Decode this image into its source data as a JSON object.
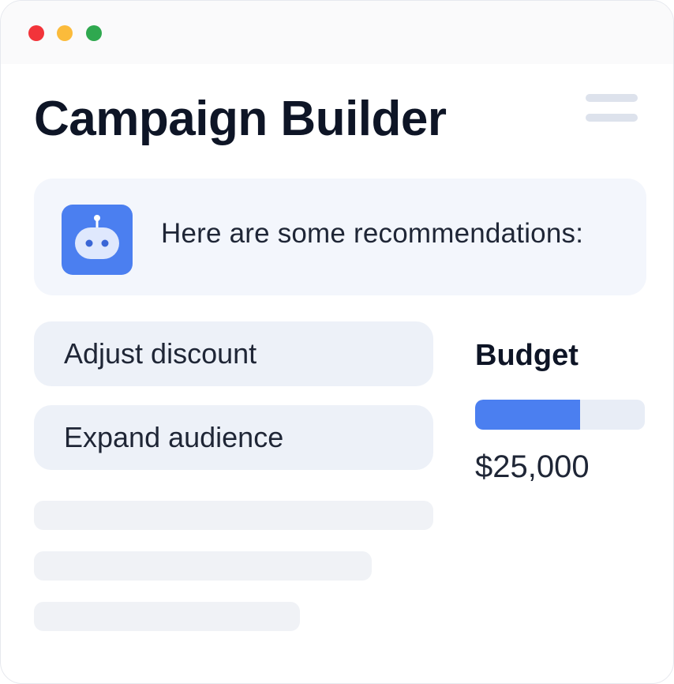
{
  "window": {
    "controls": [
      "close",
      "minimize",
      "maximize"
    ],
    "control_colors": {
      "close": "#f2343a",
      "minimize": "#fbbb3b",
      "maximize": "#2fa84f"
    }
  },
  "header": {
    "title": "Campaign Builder",
    "menu_icon": "hamburger-menu-icon"
  },
  "assistant": {
    "avatar_icon": "robot-icon",
    "message": "Here are some recommendations:",
    "accent": "#4b7ff0"
  },
  "suggestions": [
    {
      "label": "Adjust discount"
    },
    {
      "label": "Expand audience"
    }
  ],
  "budget": {
    "label": "Budget",
    "value": "$25,000",
    "progress_fraction": 0.62
  }
}
